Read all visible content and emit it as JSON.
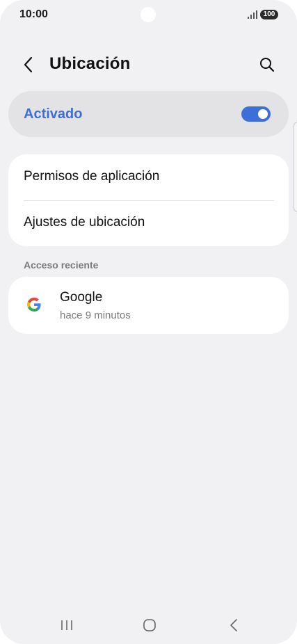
{
  "status_bar": {
    "time": "10:00",
    "battery": "100",
    "icons": [
      "signal-icon",
      "battery-icon"
    ]
  },
  "header": {
    "title": "Ubicación",
    "back_icon": "chevron-left-icon",
    "search_icon": "search-icon"
  },
  "location_toggle": {
    "label": "Activado",
    "state": "on",
    "accent_color": "#3e6fd8"
  },
  "settings": {
    "items": [
      {
        "label": "Permisos de aplicación"
      },
      {
        "label": "Ajustes de ubicación"
      }
    ]
  },
  "recent_access": {
    "section_title": "Acceso reciente",
    "apps": [
      {
        "name": "Google",
        "time": "hace 9 minutos",
        "icon": "google-icon"
      }
    ]
  },
  "nav_bar": {
    "icons": [
      "recents-icon",
      "home-icon",
      "back-icon"
    ]
  }
}
